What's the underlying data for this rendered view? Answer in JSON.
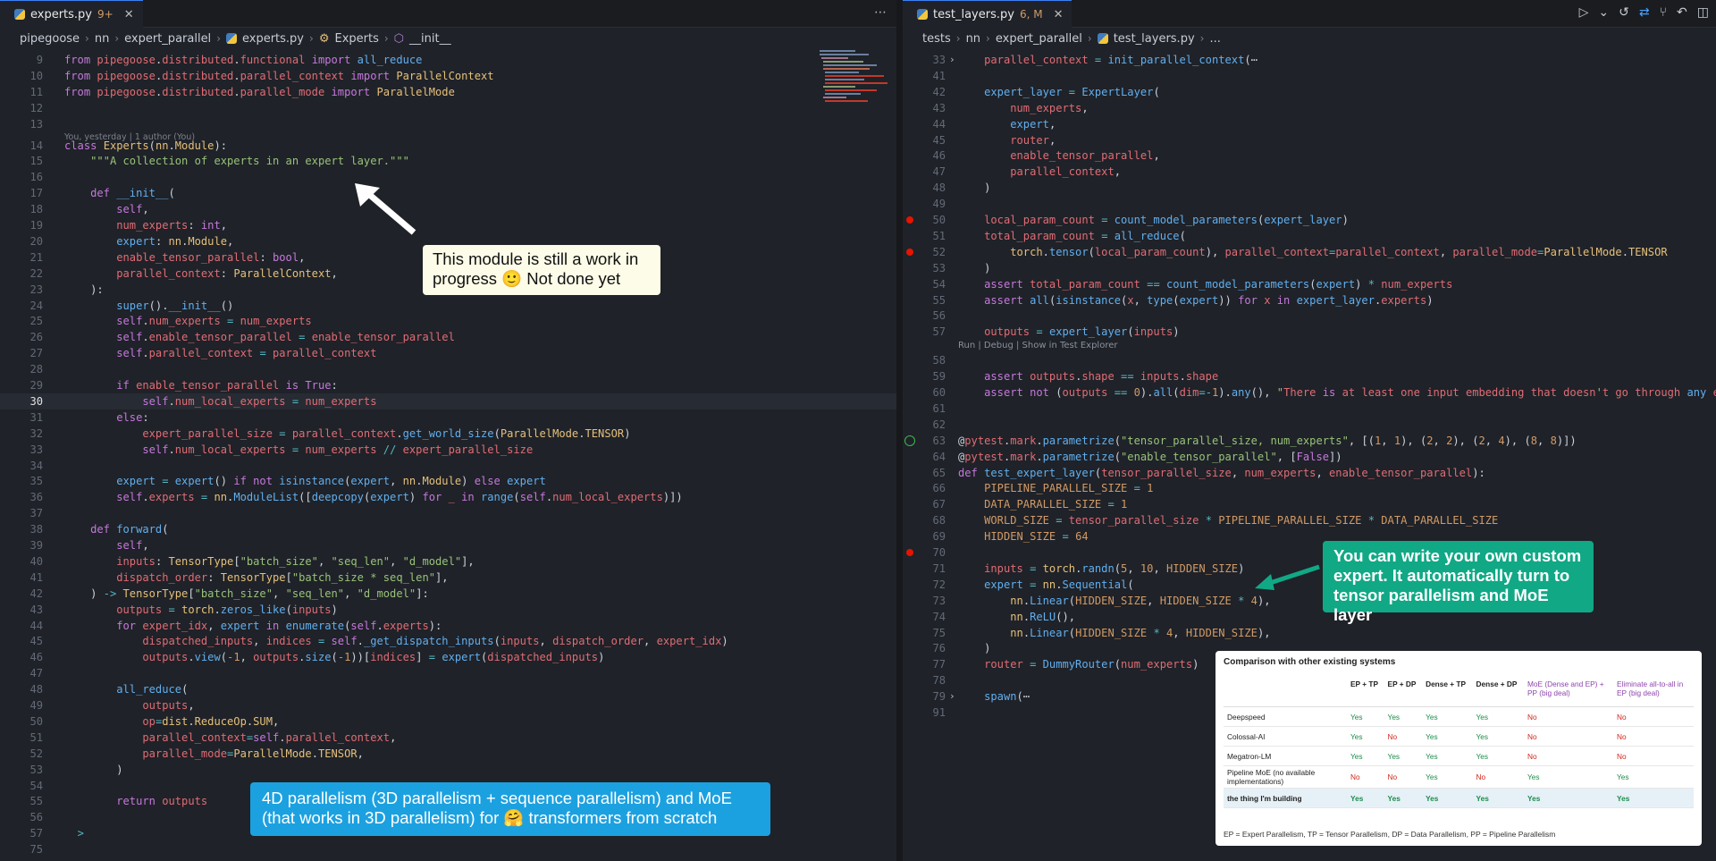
{
  "left": {
    "tab": {
      "label": "experts.py",
      "badge": "9+"
    },
    "breadcrumbs": [
      "pipegoose",
      "nn",
      "expert_parallel",
      "experts.py",
      "Experts",
      "__init__"
    ],
    "blame": "You, yesterday | 1 author (You)",
    "lines": [
      {
        "n": "9",
        "t": "from pipegoose.distributed.functional import all_reduce"
      },
      {
        "n": "10",
        "t": "from pipegoose.distributed.parallel_context import ParallelContext"
      },
      {
        "n": "11",
        "t": "from pipegoose.distributed.parallel_mode import ParallelMode"
      },
      {
        "n": "12",
        "t": ""
      },
      {
        "n": "13",
        "t": ""
      },
      {
        "n": "14",
        "t": "class Experts(nn.Module):"
      },
      {
        "n": "15",
        "t": "    \"\"\"A collection of experts in an expert layer.\"\"\""
      },
      {
        "n": "16",
        "t": ""
      },
      {
        "n": "17",
        "t": "    def __init__("
      },
      {
        "n": "18",
        "t": "        self,"
      },
      {
        "n": "19",
        "t": "        num_experts: int,"
      },
      {
        "n": "20",
        "t": "        expert: nn.Module,"
      },
      {
        "n": "21",
        "t": "        enable_tensor_parallel: bool,"
      },
      {
        "n": "22",
        "t": "        parallel_context: ParallelContext,"
      },
      {
        "n": "23",
        "t": "    ):"
      },
      {
        "n": "24",
        "t": "        super().__init__()"
      },
      {
        "n": "25",
        "t": "        self.num_experts = num_experts"
      },
      {
        "n": "26",
        "t": "        self.enable_tensor_parallel = enable_tensor_parallel"
      },
      {
        "n": "27",
        "t": "        self.parallel_context = parallel_context"
      },
      {
        "n": "28",
        "t": ""
      },
      {
        "n": "29",
        "t": "        if enable_tensor_parallel is True:"
      },
      {
        "n": "30",
        "t": "            self.num_local_experts = num_experts"
      },
      {
        "n": "31",
        "t": "        else:"
      },
      {
        "n": "32",
        "t": "            expert_parallel_size = parallel_context.get_world_size(ParallelMode.TENSOR)"
      },
      {
        "n": "33",
        "t": "            self.num_local_experts = num_experts // expert_parallel_size"
      },
      {
        "n": "34",
        "t": ""
      },
      {
        "n": "35",
        "t": "        expert = expert() if not isinstance(expert, nn.Module) else expert"
      },
      {
        "n": "36",
        "t": "        self.experts = nn.ModuleList([deepcopy(expert) for _ in range(self.num_local_experts)])"
      },
      {
        "n": "37",
        "t": ""
      },
      {
        "n": "38",
        "t": "    def forward("
      },
      {
        "n": "39",
        "t": "        self,"
      },
      {
        "n": "40",
        "t": "        inputs: TensorType[\"batch_size\", \"seq_len\", \"d_model\"],"
      },
      {
        "n": "41",
        "t": "        dispatch_order: TensorType[\"batch_size * seq_len\"],"
      },
      {
        "n": "42",
        "t": "    ) -> TensorType[\"batch_size\", \"seq_len\", \"d_model\"]:"
      },
      {
        "n": "43",
        "t": "        outputs = torch.zeros_like(inputs)"
      },
      {
        "n": "44",
        "t": "        for expert_idx, expert in enumerate(self.experts):"
      },
      {
        "n": "45",
        "t": "            dispatched_inputs, indices = self._get_dispatch_inputs(inputs, dispatch_order, expert_idx)"
      },
      {
        "n": "46",
        "t": "            outputs.view(-1, outputs.size(-1))[indices] = expert(dispatched_inputs)"
      },
      {
        "n": "47",
        "t": ""
      },
      {
        "n": "48",
        "t": "        all_reduce("
      },
      {
        "n": "49",
        "t": "            outputs,"
      },
      {
        "n": "50",
        "t": "            op=dist.ReduceOp.SUM,"
      },
      {
        "n": "51",
        "t": "            parallel_context=self.parallel_context,"
      },
      {
        "n": "52",
        "t": "            parallel_mode=ParallelMode.TENSOR,"
      },
      {
        "n": "53",
        "t": "        )"
      },
      {
        "n": "54",
        "t": ""
      },
      {
        "n": "55",
        "t": "        return outputs"
      },
      {
        "n": "56",
        "t": ""
      },
      {
        "n": "57",
        "t": "  >"
      },
      {
        "n": "75",
        "t": ""
      }
    ],
    "callout_wip": "This module is still a work in progress 🙂 Not done yet",
    "callout_4d": "4D parallelism (3D parallelism + sequence parallelism) and MoE (that works in 3D parallelism) for 🤗 transformers from scratch"
  },
  "right": {
    "tab": {
      "label": "test_layers.py",
      "badge": "6, M"
    },
    "breadcrumbs": [
      "tests",
      "nn",
      "expert_parallel",
      "test_layers.py",
      "..."
    ],
    "codelens": "Run | Debug | Show in Test Explorer",
    "lines": [
      {
        "n": "33",
        "t": "    parallel_context = init_parallel_context(⋯"
      },
      {
        "n": "41",
        "t": ""
      },
      {
        "n": "42",
        "t": "    expert_layer = ExpertLayer("
      },
      {
        "n": "43",
        "t": "        num_experts,"
      },
      {
        "n": "44",
        "t": "        expert,"
      },
      {
        "n": "45",
        "t": "        router,"
      },
      {
        "n": "46",
        "t": "        enable_tensor_parallel,"
      },
      {
        "n": "47",
        "t": "        parallel_context,"
      },
      {
        "n": "48",
        "t": "    )"
      },
      {
        "n": "49",
        "t": ""
      },
      {
        "n": "50",
        "t": "    local_param_count = count_model_parameters(expert_layer)"
      },
      {
        "n": "51",
        "t": "    total_param_count = all_reduce("
      },
      {
        "n": "52",
        "t": "        torch.tensor(local_param_count), parallel_context=parallel_context, parallel_mode=ParallelMode.TENSOR"
      },
      {
        "n": "53",
        "t": "    )"
      },
      {
        "n": "54",
        "t": "    assert total_param_count == count_model_parameters(expert) * num_experts"
      },
      {
        "n": "55",
        "t": "    assert all(isinstance(x, type(expert)) for x in expert_layer.experts)"
      },
      {
        "n": "56",
        "t": ""
      },
      {
        "n": "57",
        "t": "    outputs = expert_layer(inputs)"
      },
      {
        "n": "58",
        "t": ""
      },
      {
        "n": "59",
        "t": "    assert outputs.shape == inputs.shape"
      },
      {
        "n": "60",
        "t": "    assert not (outputs == 0).all(dim=-1).any(), \"There is at least one input embedding that doesn't go through any e"
      },
      {
        "n": "61",
        "t": ""
      },
      {
        "n": "62",
        "t": ""
      },
      {
        "n": "63",
        "t": "@pytest.mark.parametrize(\"tensor_parallel_size, num_experts\", [(1, 1), (2, 2), (2, 4), (8, 8)])"
      },
      {
        "n": "64",
        "t": "@pytest.mark.parametrize(\"enable_tensor_parallel\", [False])"
      },
      {
        "n": "65",
        "t": "def test_expert_layer(tensor_parallel_size, num_experts, enable_tensor_parallel):"
      },
      {
        "n": "66",
        "t": "    PIPELINE_PARALLEL_SIZE = 1"
      },
      {
        "n": "67",
        "t": "    DATA_PARALLEL_SIZE = 1"
      },
      {
        "n": "68",
        "t": "    WORLD_SIZE = tensor_parallel_size * PIPELINE_PARALLEL_SIZE * DATA_PARALLEL_SIZE"
      },
      {
        "n": "69",
        "t": "    HIDDEN_SIZE = 64"
      },
      {
        "n": "70",
        "t": ""
      },
      {
        "n": "71",
        "t": "    inputs = torch.randn(5, 10, HIDDEN_SIZE)"
      },
      {
        "n": "72",
        "t": "    expert = nn.Sequential("
      },
      {
        "n": "73",
        "t": "        nn.Linear(HIDDEN_SIZE, HIDDEN_SIZE * 4),"
      },
      {
        "n": "74",
        "t": "        nn.ReLU(),"
      },
      {
        "n": "75",
        "t": "        nn.Linear(HIDDEN_SIZE * 4, HIDDEN_SIZE),"
      },
      {
        "n": "76",
        "t": "    )"
      },
      {
        "n": "77",
        "t": "    router = DummyRouter(num_experts)"
      },
      {
        "n": "78",
        "t": ""
      },
      {
        "n": "79",
        "t": "    spawn(⋯"
      },
      {
        "n": "91",
        "t": ""
      }
    ],
    "callout_custom": "You can write your own custom expert. It automatically turn to tensor parallelism and MoE layer"
  },
  "comparison": {
    "title": "Comparison with other existing systems",
    "headers": [
      "",
      "EP + TP",
      "EP + DP",
      "Dense + TP",
      "Dense + DP",
      "MoE (Dense and EP) + PP (big deal)",
      "Eliminate all-to-all in EP (big deal)"
    ],
    "rows": [
      {
        "name": "Deepspeed",
        "cells": [
          "Yes",
          "Yes",
          "Yes",
          "Yes",
          "No",
          "No"
        ]
      },
      {
        "name": "Colossal-AI",
        "cells": [
          "Yes",
          "No",
          "Yes",
          "Yes",
          "No",
          "No"
        ]
      },
      {
        "name": "Megatron-LM",
        "cells": [
          "Yes",
          "Yes",
          "Yes",
          "Yes",
          "No",
          "No"
        ]
      },
      {
        "name": "Pipeline MoE (no available implementations)",
        "cells": [
          "No",
          "No",
          "Yes",
          "No",
          "Yes",
          "Yes"
        ]
      },
      {
        "name": "the thing I'm building",
        "cells": [
          "Yes",
          "Yes",
          "Yes",
          "Yes",
          "Yes",
          "Yes"
        ]
      }
    ],
    "footnote": "EP = Expert Parallelism, TP = Tensor Parallelism, DP = Data Parallelism, PP = Pipeline Parallelism"
  },
  "colors": {
    "accent": "#3b82f6",
    "callout_green": "#11a886",
    "callout_blue": "#1ca1e0",
    "callout_light": "#fdfce8",
    "breakpoint": "#e51400"
  }
}
